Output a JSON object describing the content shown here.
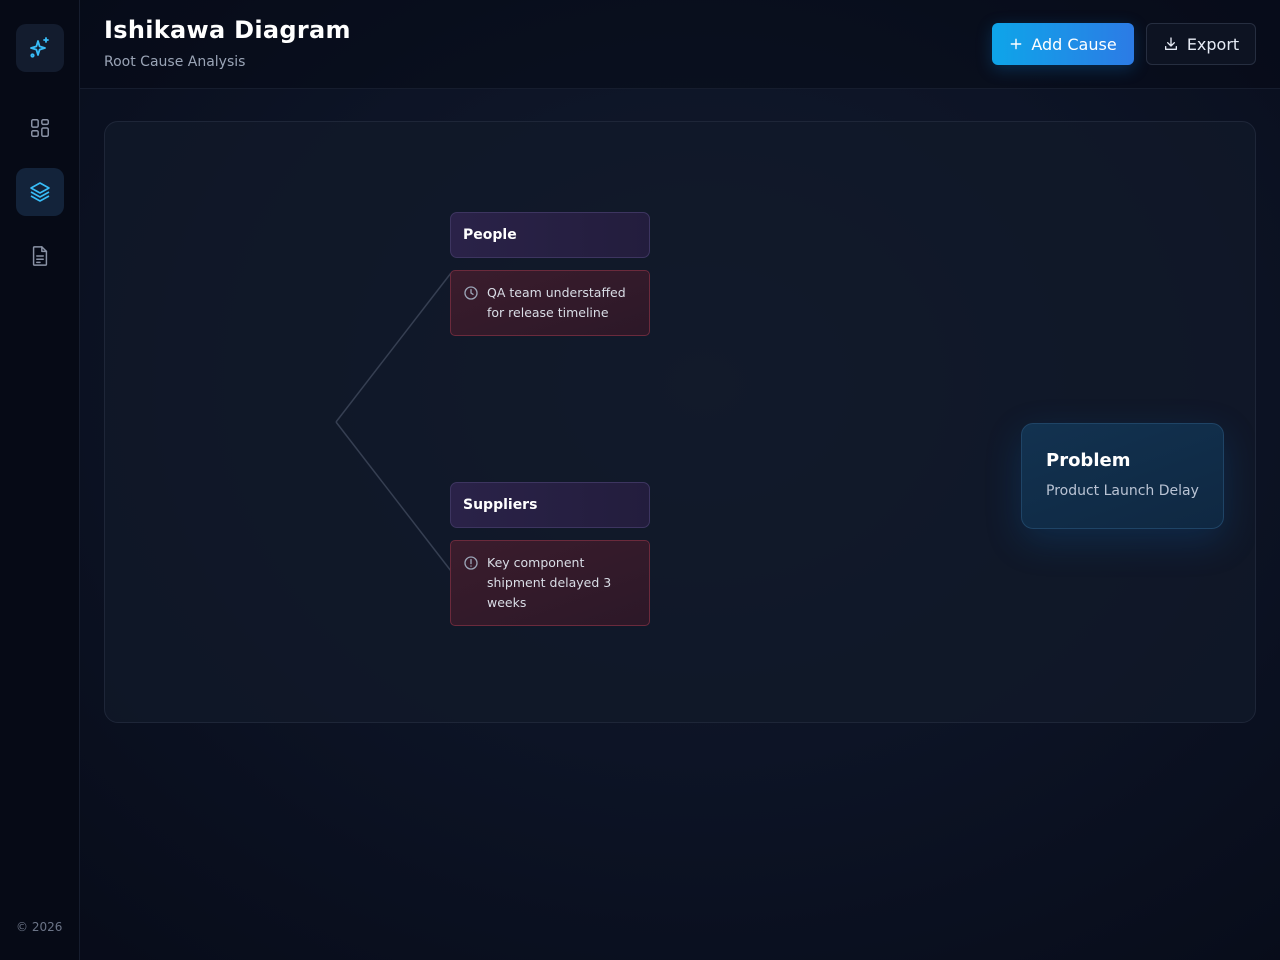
{
  "header": {
    "title": "Ishikawa Diagram",
    "subtitle": "Root Cause Analysis",
    "add_cause_label": "Add Cause",
    "export_label": "Export"
  },
  "sidebar": {
    "logo_icon": "sparkles-icon",
    "items": [
      {
        "icon": "grid-icon",
        "active": false
      },
      {
        "icon": "layers-icon",
        "active": true
      },
      {
        "icon": "document-icon",
        "active": false
      }
    ],
    "copyright": "© 2026"
  },
  "diagram": {
    "problem": {
      "title": "Problem",
      "description": "Product Launch Delay"
    },
    "categories": [
      {
        "name": "People",
        "causes": [
          {
            "icon": "clock-icon",
            "text": "QA team understaffed for release timeline"
          }
        ]
      },
      {
        "name": "Suppliers",
        "causes": [
          {
            "icon": "alert-circle-icon",
            "text": "Key component shipment delayed 3 weeks"
          }
        ]
      }
    ]
  },
  "colors": {
    "accent": "#0ea5e9",
    "accent_end": "#2c7be5",
    "category_bg": "#2a2248",
    "cause_border": "#6b2a3c",
    "problem_bg": "#123250"
  }
}
